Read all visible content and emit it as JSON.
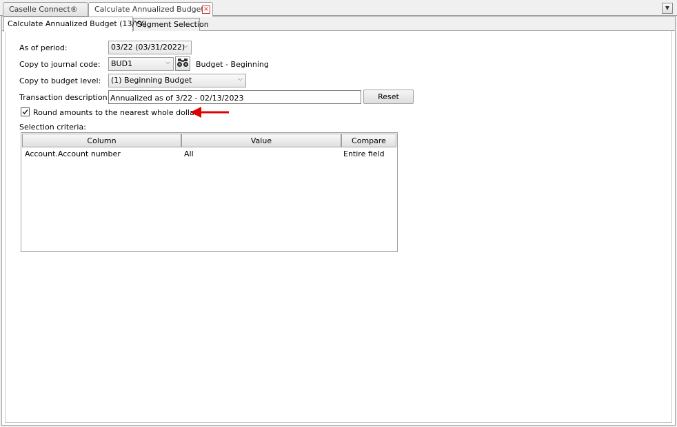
{
  "doc_tabs": [
    {
      "label": "Caselle Connect®"
    },
    {
      "label": "Calculate Annualized Budget..."
    }
  ],
  "sub_tabs": [
    {
      "label": "Calculate Annualized Budget (13/YY)"
    },
    {
      "label": "Segment Selection"
    }
  ],
  "form": {
    "as_of_period_label": "As of period:",
    "as_of_period_value": "03/22 (03/31/2022)",
    "journal_code_label": "Copy to journal code:",
    "journal_code_value": "BUD1",
    "journal_code_desc": "Budget - Beginning",
    "budget_level_label": "Copy to budget level:",
    "budget_level_value": "(1) Beginning Budget",
    "transaction_desc_label": "Transaction description:",
    "transaction_desc_value": "Annualized as of 3/22 - 02/13/2023",
    "reset_label": "Reset",
    "round_label": "Round amounts to the nearest whole dollar",
    "round_checked": true,
    "selection_criteria_label": "Selection criteria:"
  },
  "grid": {
    "columns": [
      "Column",
      "Value",
      "Compare"
    ],
    "rows": [
      [
        "Account.Account number",
        "All",
        "Entire field"
      ]
    ]
  },
  "colors": {
    "annotation_arrow": "#e00000"
  }
}
